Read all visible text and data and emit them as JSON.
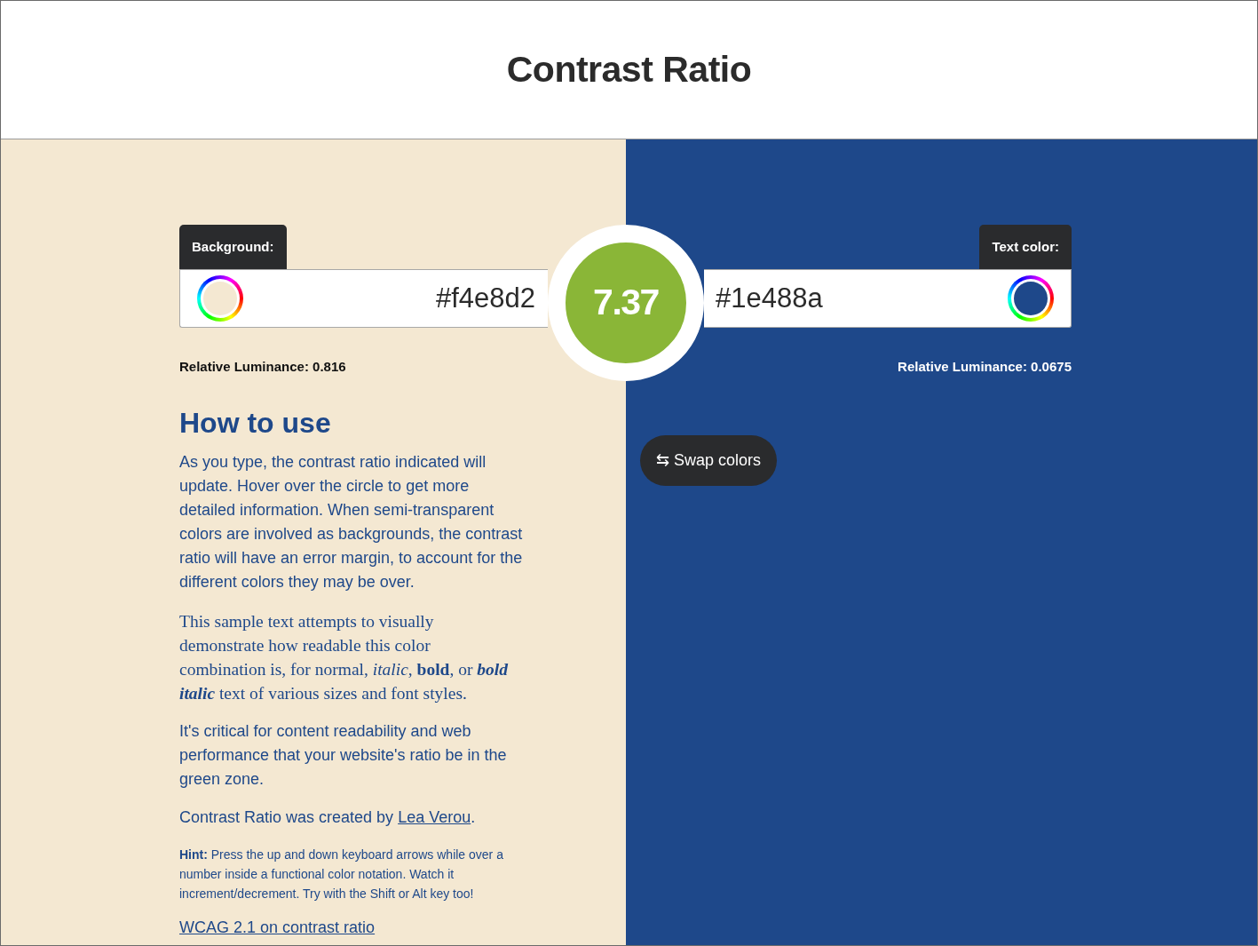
{
  "header": {
    "title": "Contrast Ratio"
  },
  "color_inputs": [
    {
      "kind": "background",
      "label": "Background:",
      "value": "#f4e8d2",
      "color": "#f4e8d2",
      "luminance_label": "Relative Luminance:",
      "luminance": "0.816"
    },
    {
      "kind": "text",
      "label": "Text color:",
      "value": "#1e488a",
      "color": "#1e488a",
      "luminance_label": "Relative Luminance:",
      "luminance": "0.0675"
    }
  ],
  "ratio": {
    "value": "7.37",
    "color": "#8ab637"
  },
  "instructions": {
    "heading": "How to use",
    "paragraphs": [
      {
        "kind": "text",
        "text": "As you type, the contrast ratio indicated will update. Hover over the circle to get more detailed information. When semi-transparent colors are involved as backgrounds, the contrast ratio will have an error margin, to account for the different colors they may be over."
      },
      {
        "kind": "sample",
        "segments": [
          {
            "kind": "plain",
            "text": "This sample text attempts to visually demonstrate how readable this color combination is, for normal, "
          },
          {
            "kind": "italic",
            "text": "italic"
          },
          {
            "kind": "plain",
            "text": ", "
          },
          {
            "kind": "bold",
            "text": "bold"
          },
          {
            "kind": "plain",
            "text": ", or "
          },
          {
            "kind": "bold_italic",
            "text": "bold italic"
          },
          {
            "kind": "plain",
            "text": " text of various sizes and font styles."
          }
        ]
      },
      {
        "kind": "text",
        "text": "It's critical for content readability and web performance that your website's ratio be in the green zone."
      },
      {
        "kind": "credit",
        "text": "Contrast Ratio was created by ",
        "link": "Lea Verou",
        "after": "."
      },
      {
        "kind": "hint",
        "text": "**Hint:** Press the up and down keyboard arrows while over a number inside a functional color notation. Watch it increment/decrement. Try with the Shift or Alt key too!"
      },
      {
        "kind": "link",
        "link": "WCAG 2.1 on contrast ratio"
      }
    ]
  },
  "swap_button": {
    "label": "⇆ Swap colors"
  }
}
